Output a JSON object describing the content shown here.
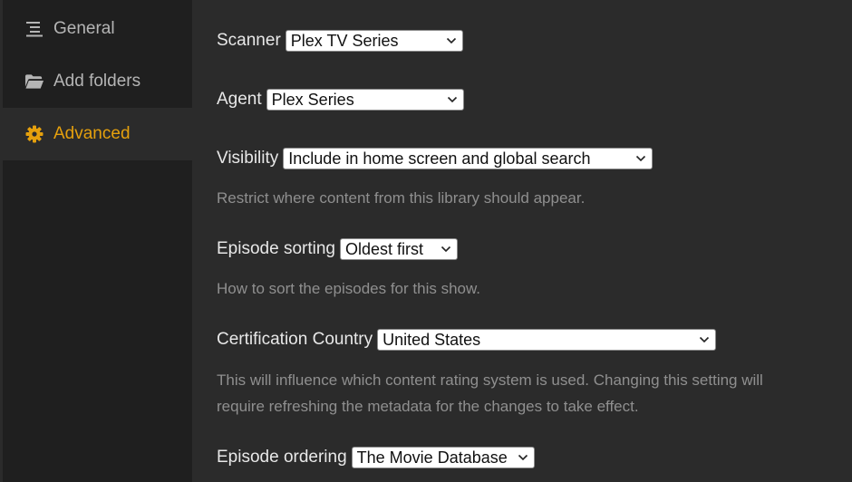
{
  "sidebar": {
    "items": [
      {
        "label": "General",
        "icon": "list-lines-icon",
        "active": false
      },
      {
        "label": "Add folders",
        "icon": "folder-open-icon",
        "active": false
      },
      {
        "label": "Advanced",
        "icon": "gear-icon",
        "active": true
      }
    ]
  },
  "settings": {
    "scanner": {
      "label": "Scanner",
      "value": "Plex TV Series"
    },
    "agent": {
      "label": "Agent",
      "value": "Plex Series"
    },
    "visibility": {
      "label": "Visibility",
      "value": "Include in home screen and global search",
      "help": "Restrict where content from this library should appear."
    },
    "episode_sorting": {
      "label": "Episode sorting",
      "value": "Oldest first",
      "help": "How to sort the episodes for this show."
    },
    "certification_country": {
      "label": "Certification Country",
      "value": "United States",
      "help_line1": "This will influence which content rating system is used. Changing this setting will",
      "help_line2": "require refreshing the metadata for the changes to take effect."
    },
    "episode_ordering": {
      "label": "Episode ordering",
      "value": "The Movie Database"
    }
  },
  "colors": {
    "accent": "#e5a00d",
    "sidebar_bg": "#1f1f1f",
    "main_bg": "#2b2b2b",
    "help_text": "#8f8f8f"
  }
}
